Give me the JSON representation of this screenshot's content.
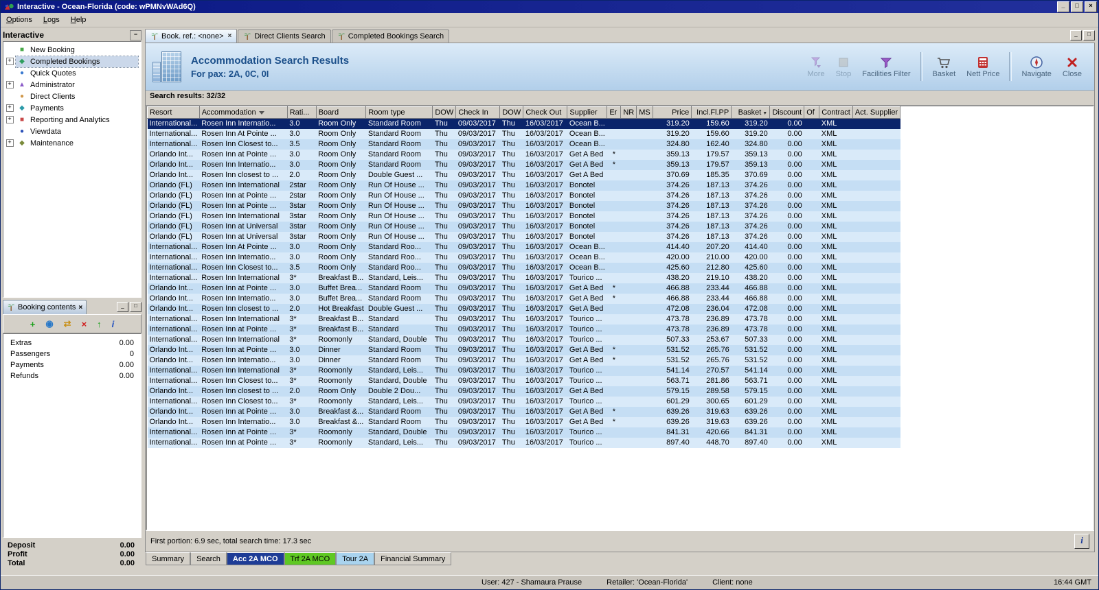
{
  "window": {
    "title": "Interactive - Ocean-Florida (code: wPMNvWAd6Q)"
  },
  "icons": {
    "minimize_glyph": "_",
    "maximize_glyph": "□",
    "close_glyph": "×",
    "collapse_glyph": "−",
    "expand_glyph": "+",
    "sort_desc_glyph": "▼",
    "info_glyph": "i"
  },
  "menu_bar": {
    "items": [
      "Options",
      "Logs",
      "Help"
    ]
  },
  "sidebar": {
    "title": "Interactive",
    "items": [
      {
        "label": "New Booking",
        "expand": false,
        "selected": false,
        "icon_glyph": "■",
        "icon_color": "#48a848"
      },
      {
        "label": "Completed Bookings",
        "expand": true,
        "selected": true,
        "icon_glyph": "◆",
        "icon_color": "#2e9e5e"
      },
      {
        "label": "Quick Quotes",
        "expand": false,
        "selected": false,
        "icon_glyph": "●",
        "icon_color": "#3a7ad0"
      },
      {
        "label": "Administrator",
        "expand": true,
        "selected": false,
        "icon_glyph": "▲",
        "icon_color": "#8a5ac8"
      },
      {
        "label": "Direct Clients",
        "expand": false,
        "selected": false,
        "icon_glyph": "●",
        "icon_color": "#d0984a"
      },
      {
        "label": "Payments",
        "expand": true,
        "selected": false,
        "icon_glyph": "◆",
        "icon_color": "#2a9aa8"
      },
      {
        "label": "Reporting and Analytics",
        "expand": true,
        "selected": false,
        "icon_glyph": "■",
        "icon_color": "#c84848"
      },
      {
        "label": "Viewdata",
        "expand": false,
        "selected": false,
        "icon_glyph": "●",
        "icon_color": "#2a50b8"
      },
      {
        "label": "Maintenance",
        "expand": true,
        "selected": false,
        "icon_glyph": "◆",
        "icon_color": "#7a8a3a"
      }
    ]
  },
  "booking_contents": {
    "title": "Booking contents",
    "toolbar": [
      {
        "name": "add-item",
        "glyph": "+",
        "color": "#18a018"
      },
      {
        "name": "globe-search",
        "glyph": "◉",
        "color": "#2878c8"
      },
      {
        "name": "transfer",
        "glyph": "⇄",
        "color": "#c89018"
      },
      {
        "name": "delete-item",
        "glyph": "×",
        "color": "#d02020"
      },
      {
        "name": "move-up",
        "glyph": "↑",
        "color": "#18a018"
      },
      {
        "name": "info",
        "glyph": "i",
        "color": "#2050c0",
        "italic": true
      }
    ],
    "rows": [
      {
        "label": "Extras",
        "value": "0.00"
      },
      {
        "label": "Passengers",
        "value": "0"
      },
      {
        "label": "Payments",
        "value": "0.00"
      },
      {
        "label": "Refunds",
        "value": "0.00"
      }
    ],
    "totals": [
      {
        "label": "Deposit",
        "value": "0.00"
      },
      {
        "label": "Profit",
        "value": "0.00"
      },
      {
        "label": "Total",
        "value": "0.00"
      }
    ]
  },
  "mdi_tabs": [
    {
      "label": "Book. ref.: <none>",
      "active": true,
      "closable": true
    },
    {
      "label": "Direct Clients Search",
      "active": false,
      "closable": false
    },
    {
      "label": "Completed Bookings Search",
      "active": false,
      "closable": false
    }
  ],
  "results_header": {
    "title": "Accommodation Search Results",
    "subtitle": "For pax: 2A, 0C, 0I",
    "toolbar": [
      {
        "label": "More",
        "icon": "more",
        "disabled": true
      },
      {
        "label": "Stop",
        "icon": "stop",
        "disabled": true
      },
      {
        "label": "Facilities Filter",
        "icon": "filter",
        "disabled": false
      },
      {
        "label": "Basket",
        "icon": "basket",
        "disabled": false,
        "sep_before": true
      },
      {
        "label": "Nett Price",
        "icon": "nett",
        "disabled": false
      },
      {
        "label": "Navigate",
        "icon": "navigate",
        "disabled": false,
        "sep_before": true
      },
      {
        "label": "Close",
        "icon": "close",
        "disabled": false
      }
    ]
  },
  "results": {
    "count_label": "Search results: 32/32",
    "selected_row": 0,
    "columns": [
      "Resort",
      "Accommodation",
      "Rati...",
      "Board",
      "Room type",
      "DOW",
      "Check In",
      "DOW",
      "Check Out",
      "Supplier",
      "Er",
      "NR",
      "MS",
      "Price",
      "Incl.Fl.PP",
      "Basket",
      "Discount",
      "Of",
      "Contract",
      "Act. Supplier"
    ],
    "rows": [
      [
        "International...",
        "Rosen Inn Internatio...",
        "3.0",
        "Room Only",
        "Standard Room",
        "Thu",
        "09/03/2017",
        "Thu",
        "16/03/2017",
        "Ocean B...",
        "",
        "",
        "",
        "319.20",
        "159.60",
        "319.20",
        "0.00",
        "",
        "XML",
        ""
      ],
      [
        "International...",
        "Rosen Inn At Pointe ...",
        "3.0",
        "Room Only",
        "Standard Room",
        "Thu",
        "09/03/2017",
        "Thu",
        "16/03/2017",
        "Ocean B...",
        "",
        "",
        "",
        "319.20",
        "159.60",
        "319.20",
        "0.00",
        "",
        "XML",
        ""
      ],
      [
        "International...",
        "Rosen Inn Closest to...",
        "3.5",
        "Room Only",
        "Standard Room",
        "Thu",
        "09/03/2017",
        "Thu",
        "16/03/2017",
        "Ocean B...",
        "",
        "",
        "",
        "324.80",
        "162.40",
        "324.80",
        "0.00",
        "",
        "XML",
        ""
      ],
      [
        "Orlando Int...",
        "Rosen Inn at Pointe ...",
        "3.0",
        "Room Only",
        "Standard Room",
        "Thu",
        "09/03/2017",
        "Thu",
        "16/03/2017",
        "Get A Bed",
        "*",
        "",
        "",
        "359.13",
        "179.57",
        "359.13",
        "0.00",
        "",
        "XML",
        ""
      ],
      [
        "Orlando Int...",
        "Rosen Inn Internatio...",
        "3.0",
        "Room Only",
        "Standard Room",
        "Thu",
        "09/03/2017",
        "Thu",
        "16/03/2017",
        "Get A Bed",
        "*",
        "",
        "",
        "359.13",
        "179.57",
        "359.13",
        "0.00",
        "",
        "XML",
        ""
      ],
      [
        "Orlando Int...",
        "Rosen Inn closest to ...",
        "2.0",
        "Room Only",
        "Double Guest ...",
        "Thu",
        "09/03/2017",
        "Thu",
        "16/03/2017",
        "Get A Bed",
        "",
        "",
        "",
        "370.69",
        "185.35",
        "370.69",
        "0.00",
        "",
        "XML",
        ""
      ],
      [
        "Orlando (FL)",
        "Rosen Inn International",
        "2star",
        "Room Only",
        "Run Of House ...",
        "Thu",
        "09/03/2017",
        "Thu",
        "16/03/2017",
        "Bonotel",
        "",
        "",
        "",
        "374.26",
        "187.13",
        "374.26",
        "0.00",
        "",
        "XML",
        ""
      ],
      [
        "Orlando (FL)",
        "Rosen Inn at Pointe ...",
        "2star",
        "Room Only",
        "Run Of House ...",
        "Thu",
        "09/03/2017",
        "Thu",
        "16/03/2017",
        "Bonotel",
        "",
        "",
        "",
        "374.26",
        "187.13",
        "374.26",
        "0.00",
        "",
        "XML",
        ""
      ],
      [
        "Orlando (FL)",
        "Rosen Inn at Pointe ...",
        "3star",
        "Room Only",
        "Run Of House ...",
        "Thu",
        "09/03/2017",
        "Thu",
        "16/03/2017",
        "Bonotel",
        "",
        "",
        "",
        "374.26",
        "187.13",
        "374.26",
        "0.00",
        "",
        "XML",
        ""
      ],
      [
        "Orlando (FL)",
        "Rosen Inn International",
        "3star",
        "Room Only",
        "Run Of House ...",
        "Thu",
        "09/03/2017",
        "Thu",
        "16/03/2017",
        "Bonotel",
        "",
        "",
        "",
        "374.26",
        "187.13",
        "374.26",
        "0.00",
        "",
        "XML",
        ""
      ],
      [
        "Orlando (FL)",
        "Rosen Inn at Universal",
        "3star",
        "Room Only",
        "Run Of House ...",
        "Thu",
        "09/03/2017",
        "Thu",
        "16/03/2017",
        "Bonotel",
        "",
        "",
        "",
        "374.26",
        "187.13",
        "374.26",
        "0.00",
        "",
        "XML",
        ""
      ],
      [
        "Orlando (FL)",
        "Rosen Inn at Universal",
        "3star",
        "Room Only",
        "Run Of House ...",
        "Thu",
        "09/03/2017",
        "Thu",
        "16/03/2017",
        "Bonotel",
        "",
        "",
        "",
        "374.26",
        "187.13",
        "374.26",
        "0.00",
        "",
        "XML",
        ""
      ],
      [
        "International...",
        "Rosen Inn At Pointe ...",
        "3.0",
        "Room Only",
        "Standard Roo...",
        "Thu",
        "09/03/2017",
        "Thu",
        "16/03/2017",
        "Ocean B...",
        "",
        "",
        "",
        "414.40",
        "207.20",
        "414.40",
        "0.00",
        "",
        "XML",
        ""
      ],
      [
        "International...",
        "Rosen Inn Internatio...",
        "3.0",
        "Room Only",
        "Standard Roo...",
        "Thu",
        "09/03/2017",
        "Thu",
        "16/03/2017",
        "Ocean B...",
        "",
        "",
        "",
        "420.00",
        "210.00",
        "420.00",
        "0.00",
        "",
        "XML",
        ""
      ],
      [
        "International...",
        "Rosen Inn Closest to...",
        "3.5",
        "Room Only",
        "Standard Roo...",
        "Thu",
        "09/03/2017",
        "Thu",
        "16/03/2017",
        "Ocean B...",
        "",
        "",
        "",
        "425.60",
        "212.80",
        "425.60",
        "0.00",
        "",
        "XML",
        ""
      ],
      [
        "International...",
        "Rosen Inn International",
        "3*",
        "Breakfast B...",
        "Standard, Leis...",
        "Thu",
        "09/03/2017",
        "Thu",
        "16/03/2017",
        "Tourico ...",
        "",
        "",
        "",
        "438.20",
        "219.10",
        "438.20",
        "0.00",
        "",
        "XML",
        ""
      ],
      [
        "Orlando Int...",
        "Rosen Inn at Pointe ...",
        "3.0",
        "Buffet Brea...",
        "Standard Room",
        "Thu",
        "09/03/2017",
        "Thu",
        "16/03/2017",
        "Get A Bed",
        "*",
        "",
        "",
        "466.88",
        "233.44",
        "466.88",
        "0.00",
        "",
        "XML",
        ""
      ],
      [
        "Orlando Int...",
        "Rosen Inn Internatio...",
        "3.0",
        "Buffet Brea...",
        "Standard Room",
        "Thu",
        "09/03/2017",
        "Thu",
        "16/03/2017",
        "Get A Bed",
        "*",
        "",
        "",
        "466.88",
        "233.44",
        "466.88",
        "0.00",
        "",
        "XML",
        ""
      ],
      [
        "Orlando Int...",
        "Rosen Inn closest to ...",
        "2.0",
        "Hot Breakfast",
        "Double Guest ...",
        "Thu",
        "09/03/2017",
        "Thu",
        "16/03/2017",
        "Get A Bed",
        "",
        "",
        "",
        "472.08",
        "236.04",
        "472.08",
        "0.00",
        "",
        "XML",
        ""
      ],
      [
        "International...",
        "Rosen Inn International",
        "3*",
        "Breakfast B...",
        "Standard",
        "Thu",
        "09/03/2017",
        "Thu",
        "16/03/2017",
        "Tourico ...",
        "",
        "",
        "",
        "473.78",
        "236.89",
        "473.78",
        "0.00",
        "",
        "XML",
        ""
      ],
      [
        "International...",
        "Rosen Inn at Pointe ...",
        "3*",
        "Breakfast B...",
        "Standard",
        "Thu",
        "09/03/2017",
        "Thu",
        "16/03/2017",
        "Tourico ...",
        "",
        "",
        "",
        "473.78",
        "236.89",
        "473.78",
        "0.00",
        "",
        "XML",
        ""
      ],
      [
        "International...",
        "Rosen Inn International",
        "3*",
        "Roomonly",
        "Standard, Double",
        "Thu",
        "09/03/2017",
        "Thu",
        "16/03/2017",
        "Tourico ...",
        "",
        "",
        "",
        "507.33",
        "253.67",
        "507.33",
        "0.00",
        "",
        "XML",
        ""
      ],
      [
        "Orlando Int...",
        "Rosen Inn at Pointe ...",
        "3.0",
        "Dinner",
        "Standard Room",
        "Thu",
        "09/03/2017",
        "Thu",
        "16/03/2017",
        "Get A Bed",
        "*",
        "",
        "",
        "531.52",
        "265.76",
        "531.52",
        "0.00",
        "",
        "XML",
        ""
      ],
      [
        "Orlando Int...",
        "Rosen Inn Internatio...",
        "3.0",
        "Dinner",
        "Standard Room",
        "Thu",
        "09/03/2017",
        "Thu",
        "16/03/2017",
        "Get A Bed",
        "*",
        "",
        "",
        "531.52",
        "265.76",
        "531.52",
        "0.00",
        "",
        "XML",
        ""
      ],
      [
        "International...",
        "Rosen Inn International",
        "3*",
        "Roomonly",
        "Standard, Leis...",
        "Thu",
        "09/03/2017",
        "Thu",
        "16/03/2017",
        "Tourico ...",
        "",
        "",
        "",
        "541.14",
        "270.57",
        "541.14",
        "0.00",
        "",
        "XML",
        ""
      ],
      [
        "International...",
        "Rosen Inn Closest to...",
        "3*",
        "Roomonly",
        "Standard, Double",
        "Thu",
        "09/03/2017",
        "Thu",
        "16/03/2017",
        "Tourico ...",
        "",
        "",
        "",
        "563.71",
        "281.86",
        "563.71",
        "0.00",
        "",
        "XML",
        ""
      ],
      [
        "Orlando Int...",
        "Rosen Inn closest to ...",
        "2.0",
        "Room Only",
        "Double 2  Dou...",
        "Thu",
        "09/03/2017",
        "Thu",
        "16/03/2017",
        "Get A Bed",
        "",
        "",
        "",
        "579.15",
        "289.58",
        "579.15",
        "0.00",
        "",
        "XML",
        ""
      ],
      [
        "International...",
        "Rosen Inn Closest to...",
        "3*",
        "Roomonly",
        "Standard, Leis...",
        "Thu",
        "09/03/2017",
        "Thu",
        "16/03/2017",
        "Tourico ...",
        "",
        "",
        "",
        "601.29",
        "300.65",
        "601.29",
        "0.00",
        "",
        "XML",
        ""
      ],
      [
        "Orlando Int...",
        "Rosen Inn at Pointe ...",
        "3.0",
        "Breakfast &...",
        "Standard Room",
        "Thu",
        "09/03/2017",
        "Thu",
        "16/03/2017",
        "Get A Bed",
        "*",
        "",
        "",
        "639.26",
        "319.63",
        "639.26",
        "0.00",
        "",
        "XML",
        ""
      ],
      [
        "Orlando Int...",
        "Rosen Inn Internatio...",
        "3.0",
        "Breakfast &...",
        "Standard Room",
        "Thu",
        "09/03/2017",
        "Thu",
        "16/03/2017",
        "Get A Bed",
        "*",
        "",
        "",
        "639.26",
        "319.63",
        "639.26",
        "0.00",
        "",
        "XML",
        ""
      ],
      [
        "International...",
        "Rosen Inn at Pointe ...",
        "3*",
        "Roomonly",
        "Standard, Double",
        "Thu",
        "09/03/2017",
        "Thu",
        "16/03/2017",
        "Tourico ...",
        "",
        "",
        "",
        "841.31",
        "420.66",
        "841.31",
        "0.00",
        "",
        "XML",
        ""
      ],
      [
        "International...",
        "Rosen Inn at Pointe ...",
        "3*",
        "Roomonly",
        "Standard, Leis...",
        "Thu",
        "09/03/2017",
        "Thu",
        "16/03/2017",
        "Tourico ...",
        "",
        "",
        "",
        "897.40",
        "448.70",
        "897.40",
        "0.00",
        "",
        "XML",
        ""
      ]
    ]
  },
  "status_line": "First portion: 6.9 sec, total search time: 17.3 sec",
  "bottom_tabs": [
    {
      "label": "Summary",
      "style": "plain"
    },
    {
      "label": "Search",
      "style": "plain"
    },
    {
      "label": "Acc 2A MCO",
      "style": "acc"
    },
    {
      "label": "Trf 2A MCO",
      "style": "trf"
    },
    {
      "label": "Tour 2A",
      "style": "tour"
    },
    {
      "label": "Financial Summary",
      "style": "plain"
    }
  ],
  "status_bar": {
    "user": "User: 427 - Shamaura Prause",
    "retailer": "Retailer: 'Ocean-Florida'",
    "client": "Client: none",
    "time": "16:44 GMT"
  },
  "colors": {
    "selection": "#0a246a",
    "row_light": "#d9eaf9",
    "row_dark": "#c5def4",
    "acc_tab": "#1e3c96",
    "trf_tab": "#5fc823",
    "tour_tab": "#a9d3ee"
  }
}
